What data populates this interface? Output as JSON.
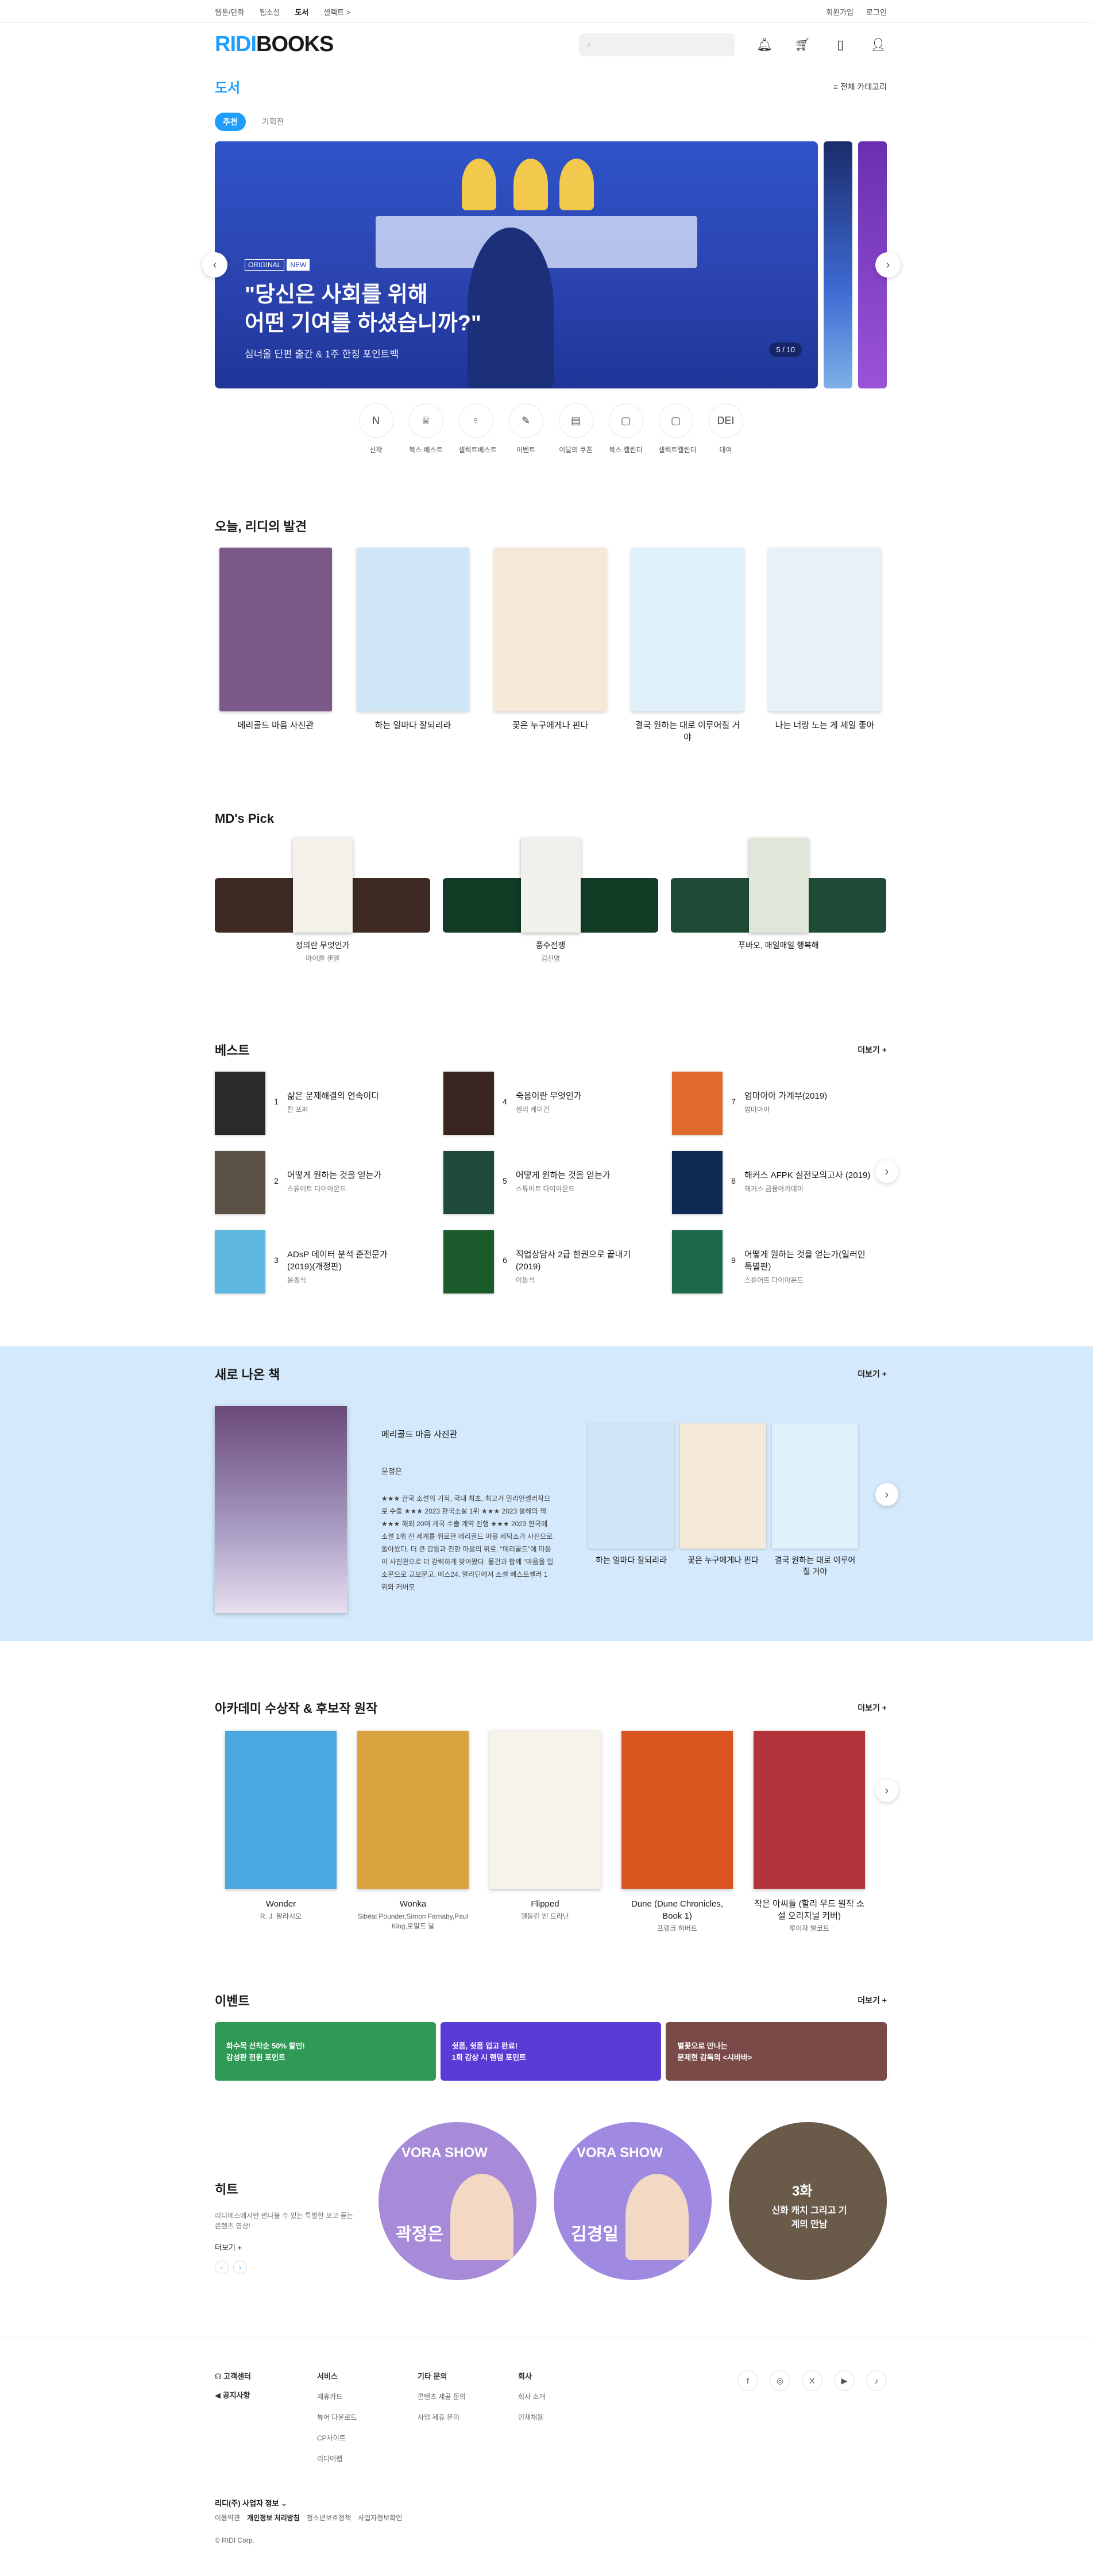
{
  "topbar": {
    "services": [
      "웹툰/만화",
      "웹소설",
      "도서",
      "셀렉트 >"
    ],
    "active": "도서",
    "account": [
      "회원가입",
      "로그인"
    ]
  },
  "header": {
    "logo_r": "RIDI",
    "logo_b": "BOOKS",
    "icons": [
      "search-icon",
      "bell-icon",
      "cart-icon",
      "library-icon",
      "user-icon"
    ]
  },
  "category": {
    "title": "도서",
    "all_label": "전체 카테고리"
  },
  "tabs": [
    "추천",
    "기획전"
  ],
  "hero": {
    "badges": [
      "ORIGINAL",
      "NEW"
    ],
    "title": "\"당신은 사회를 위해\n어떤 기여를 하셨습니까?\"",
    "subtitle": "심너울 단편 출간 & 1주 한정 포인트백",
    "pager": "5 / 10"
  },
  "quick": [
    {
      "icon": "N",
      "label": "신작"
    },
    {
      "icon": "♕",
      "label": "북스 베스트"
    },
    {
      "icon": "♀",
      "label": "셀렉트베스트"
    },
    {
      "icon": "✎",
      "label": "이벤트"
    },
    {
      "icon": "▤",
      "label": "이달의 쿠폰"
    },
    {
      "icon": "▢",
      "label": "북스 캘린더"
    },
    {
      "icon": "▢",
      "label": "셀렉트캘린더"
    },
    {
      "icon": "DEI",
      "label": "대여"
    }
  ],
  "discovery": {
    "title": "오늘, 리디의 발견",
    "books": [
      {
        "title": "메리골드 마음 사진관",
        "color": "#7b5a8a"
      },
      {
        "title": "하는 일마다 잘되리라",
        "color": "#cfe6f6"
      },
      {
        "title": "꽃은 누구에게나 핀다",
        "color": "#f7e9d8"
      },
      {
        "title": "결국 원하는 대로 이루어질 거야",
        "color": "#dff0fa"
      },
      {
        "title": "나는 너랑 노는 게 제일 좋아",
        "color": "#e8f1f8"
      }
    ]
  },
  "mdpick": {
    "title": "MD's Pick",
    "items": [
      {
        "title": "정의란 무엇인가",
        "author": "마이클 샌델",
        "bg": "#3e2a22"
      },
      {
        "title": "풍수전쟁",
        "author": "김진명",
        "bg": "#123b26"
      },
      {
        "title": "푸바오, 매일매일 행복해",
        "author": "",
        "bg": "#1f4b36"
      }
    ]
  },
  "best": {
    "title": "베스트",
    "more": "더보기 +",
    "items": [
      {
        "rank": "1",
        "title": "삶은 문제해결의 연속이다",
        "author": "칼 포퍼",
        "color": "#2a2a2a"
      },
      {
        "rank": "4",
        "title": "죽음이란 무엇인가",
        "author": "셸리 케이건",
        "color": "#3a2420"
      },
      {
        "rank": "7",
        "title": "엄마아아 가계부(2019)",
        "author": "엄마아아",
        "color": "#e06a2c"
      },
      {
        "rank": "2",
        "title": "어떻게 원하는 것을 얻는가",
        "author": "스튜어트 다이아몬드",
        "color": "#5a5044"
      },
      {
        "rank": "5",
        "title": "어떻게 원하는 것을 얻는가",
        "author": "스튜어트 다이아몬드",
        "color": "#1e4a3c"
      },
      {
        "rank": "8",
        "title": "해커스 AFPK 실전모의고사 (2019)",
        "author": "해커스 금융아카데미",
        "color": "#0f2a55"
      },
      {
        "rank": "3",
        "title": "ADsP 데이터 분석 준전문가 (2019)(개정판)",
        "author": "윤종식",
        "color": "#5fb8df"
      },
      {
        "rank": "6",
        "title": "직업상담사 2급 한권으로 끝내기(2019)",
        "author": "이동석",
        "color": "#1b5a2a"
      },
      {
        "rank": "9",
        "title": "어떻게 원하는 것을 얻는가(일러인 특별판)",
        "author": "스튜어트 다이아몬드",
        "color": "#1d6a4a"
      }
    ]
  },
  "newbooks": {
    "title": "새로 나온 책",
    "more": "더보기 +",
    "main": {
      "title": "메리골드 마음 사진관",
      "author": "윤정은",
      "desc": "★★★ 한국 소설의 기적, 국내 최초, 최고가 밀리언셀러작으로 수출 ★★★ 2023 한국소설 1위 ★★★ 2023 올해의 책 ★★★ 해외 20여 개국 수출 계약 진행 ★★★ 2023 한국에 소설 1위 전 세계를 위로한 메리골드 마을 세탁소가 사진으로 돌아왔다. 더 큰 감동과 진한 마음의 위로. \"메리골드\"에 마음이 사진관으로 더 강력하게 찾아왔다. 물건과 함께 \"마음을 입소문으로 교보문고, 예스24, 알라딘에서 소설 베스트셀러 1위와 커버모"
    },
    "side": [
      {
        "title": "하는 일마다 잘되리라",
        "color": "#cfe6f6"
      },
      {
        "title": "꽃은 누구에게나 핀다",
        "color": "#f7e9d8"
      },
      {
        "title": "결국 원하는 대로 이루어질 거야",
        "color": "#dff0fa"
      }
    ]
  },
  "academy": {
    "title": "아카데미 수상작 & 후보작 원작",
    "more": "더보기 +",
    "books": [
      {
        "title": "Wonder",
        "author": "R. J. 팔라시오",
        "color": "#4aa8e0"
      },
      {
        "title": "Wonka",
        "author": "Sibéal Pounder,Simon Farnaby,Paul King,로알드 달",
        "color": "#d9a340"
      },
      {
        "title": "Flipped",
        "author": "웬들린 밴 드라난",
        "color": "#f7f3ea"
      },
      {
        "title": "Dune (Dune Chronicles, Book 1)",
        "author": "프랭크 허버트",
        "color": "#d9541e"
      },
      {
        "title": "작은 아씨들 (할리 우드 원작 소설 오리지널 커버)",
        "author": "루이자 알코트",
        "color": "#b3333a"
      }
    ]
  },
  "events": {
    "title": "이벤트",
    "more": "더보기 +",
    "items": [
      {
        "text": "화수목 선착순 50% 할인!\n감성판 전원 포인트",
        "color": "#2f9a55"
      },
      {
        "text": "쉿폼, 쉿폼 입고 완료!\n1회 감상 시 랜덤 포인트",
        "color": "#5b3bd6"
      },
      {
        "text": "별꽃으로 만나는\n문제현 감독의 <시바바>",
        "color": "#7a4a48"
      }
    ]
  },
  "hit": {
    "title": "히트",
    "desc": "리디에스에서만 만나볼 수 있는 특별한 보고 듣는 콘텐츠 영상!",
    "more": "더보기 +",
    "items": [
      {
        "badge": "VORA SHOW",
        "name": "곽정은",
        "color": "#a78bd8"
      },
      {
        "badge": "VORA SHOW",
        "name": "김경일",
        "color": "#a089e0"
      },
      {
        "badge": "3화",
        "name": "신화 캐치 그리고 기계의 만남",
        "color": "#6a5a4a"
      }
    ]
  },
  "footer": {
    "left": [
      "고객센터",
      "공지사항"
    ],
    "cols": [
      {
        "title": "서비스",
        "items": [
          "제휴카드",
          "뷰어 다운로드",
          "CP사이트",
          "리디어랩"
        ]
      },
      {
        "title": "기타 문의",
        "items": [
          "콘텐츠 제공 문의",
          "사업 제휴 문의"
        ]
      },
      {
        "title": "회사",
        "items": [
          "회사 소개",
          "인재채용"
        ]
      }
    ],
    "social": [
      "f",
      "◎",
      "X",
      "▶",
      "♪"
    ],
    "corp_title": "리디(주) 사업자 정보 ⌄",
    "links": [
      "이용약관",
      "개인정보 처리방침",
      "청소년보호정책",
      "사업자정보확인"
    ],
    "copyright": "© RIDI Corp."
  }
}
